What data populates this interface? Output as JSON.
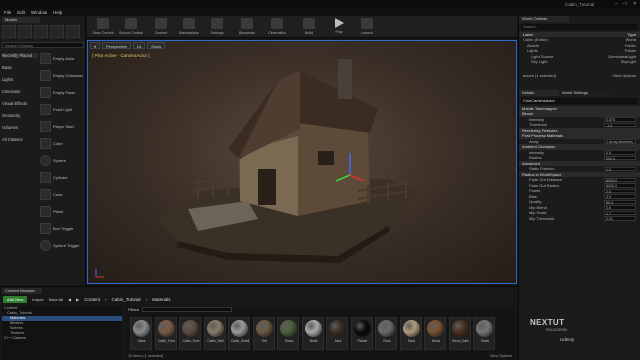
{
  "window": {
    "title": "Cabin_Tutorial"
  },
  "menu": [
    "File",
    "Edit",
    "Window",
    "Help"
  ],
  "modes": {
    "tab": "Modes",
    "search_placeholder": "Search Classes"
  },
  "place_categories": [
    "Recently Placed",
    "Basic",
    "Lights",
    "Cinematic",
    "Visual Effects",
    "Geometry",
    "Volumes",
    "All Classes"
  ],
  "place_items": [
    "Empty Actor",
    "Empty Character",
    "Empty Pawn",
    "Point Light",
    "Player Start",
    "Cube",
    "Sphere",
    "Cylinder",
    "Cone",
    "Plane",
    "Box Trigger",
    "Sphere Trigger"
  ],
  "toolbar": [
    "Save Current",
    "Source Control",
    "Content",
    "Marketplace",
    "Settings",
    "Blueprints",
    "Cinematics",
    "Build",
    "Play",
    "Launch"
  ],
  "viewport": {
    "buttons": [
      "Perspective",
      "Lit",
      "Show"
    ],
    "pilot_label": "[ Pilot Active - CameraActor ]"
  },
  "outliner": {
    "tab": "World Outliner",
    "search_placeholder": "Search...",
    "col_label": "Label",
    "col_type": "Type",
    "rows": [
      {
        "label": "Cabin (Editor)",
        "type": "World"
      },
      {
        "label": "Assets",
        "type": "Folder"
      },
      {
        "label": "Lights",
        "type": "Folder"
      },
      {
        "label": "Light Source",
        "type": "DirectionalLight"
      },
      {
        "label": "Sky Light",
        "type": "SkyLight"
      }
    ],
    "footer": "actors (1 selected)",
    "view_options": "View Options"
  },
  "details": {
    "tabs": [
      "Details",
      "World Settings"
    ],
    "selected": "CineCameraActor",
    "rows": [
      [
        "Mobile Tonemapper",
        ""
      ],
      [
        "Bloom",
        ""
      ],
      [
        "Intensity",
        "0.675"
      ],
      [
        "Threshold",
        "-1.0"
      ],
      [
        "Rendering Features",
        ""
      ],
      [
        "Post Process Materials",
        ""
      ],
      [
        "Array",
        "1 Array elements"
      ],
      [
        "Ambient Occlusion",
        ""
      ],
      [
        "Intensity",
        "0.5"
      ],
      [
        "Radius",
        "200.0"
      ],
      [
        "Advanced",
        ""
      ],
      [
        "Static Fraction",
        "1.0"
      ],
      [
        "Radius in WorldSpace",
        ""
      ],
      [
        "Fade Out Distance",
        "8000.0"
      ],
      [
        "Fade Out Radius",
        "5000.0"
      ],
      [
        "Power",
        "2.0"
      ],
      [
        "Bias",
        "3.0"
      ],
      [
        "Quality",
        "50.0"
      ],
      [
        "Mip Blend",
        "0.6"
      ],
      [
        "Mip Scale",
        "1.7"
      ],
      [
        "Mip Threshold",
        "0.01"
      ]
    ]
  },
  "content": {
    "tab": "Content Browser",
    "add_new": "Add New",
    "import": "Import",
    "save_all": "Save All",
    "breadcrumb": [
      "Content",
      "Cabin_Tutorial",
      "Materials"
    ],
    "filters": "Filters",
    "search_placeholder": "Search Materials",
    "tree": [
      "Content",
      "Cabin_Tutorial",
      "Materials",
      "Meshes",
      "Scenes",
      "Textures",
      "C++ Classes"
    ],
    "tiles": [
      "Base",
      "Cabin_Floor",
      "Cabin_Roof",
      "Cabin_Wall",
      "Cabin_Detail",
      "Dirt",
      "Grass",
      "Metal",
      "Mud",
      "Plaster",
      "Rock",
      "Sand",
      "Wood",
      "Wood_Dark",
      "Stone"
    ],
    "status": "15 items (1 selected)",
    "view_options": "View Options"
  },
  "watermark": {
    "brand": "NEXTUT",
    "tagline": "EDUCATION",
    "udemy": "Udemy"
  }
}
